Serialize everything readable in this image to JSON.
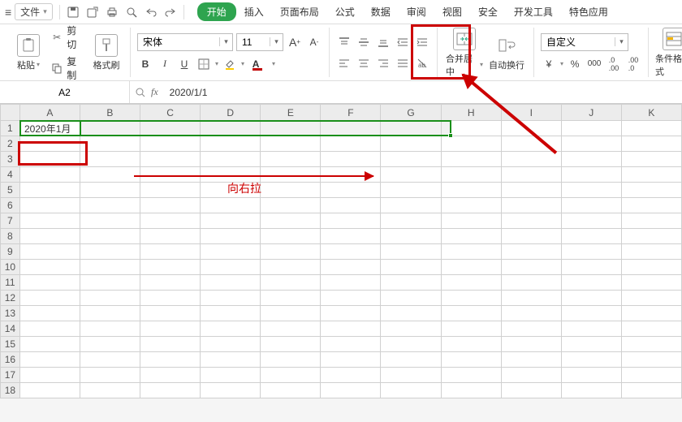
{
  "menubar": {
    "file_label": "文件",
    "tabs": [
      "开始",
      "插入",
      "页面布局",
      "公式",
      "数据",
      "审阅",
      "视图",
      "安全",
      "开发工具",
      "特色应用"
    ],
    "active_tab_index": 0
  },
  "ribbon": {
    "clipboard": {
      "paste_label": "粘贴",
      "cut_label": "剪切",
      "copy_label": "复制",
      "format_painter_label": "格式刷"
    },
    "font": {
      "name": "宋体",
      "size": "11"
    },
    "merge": {
      "label": "合并居中"
    },
    "wrap": {
      "label": "自动换行"
    },
    "numfmt": {
      "label": "自定义"
    },
    "condfmt": {
      "label": "条件格式"
    }
  },
  "formula_bar": {
    "name_box": "A2",
    "formula": "2020/1/1"
  },
  "sheet": {
    "columns": [
      "A",
      "B",
      "C",
      "D",
      "E",
      "F",
      "G",
      "H",
      "I",
      "J",
      "K"
    ],
    "rows": [
      "1",
      "2",
      "3",
      "4",
      "5",
      "6",
      "7",
      "8",
      "9",
      "10",
      "11",
      "12",
      "13",
      "14",
      "15",
      "16",
      "17",
      "18"
    ],
    "a2_value": "2020年1月"
  },
  "annotations": {
    "drag_right": "向右拉"
  }
}
